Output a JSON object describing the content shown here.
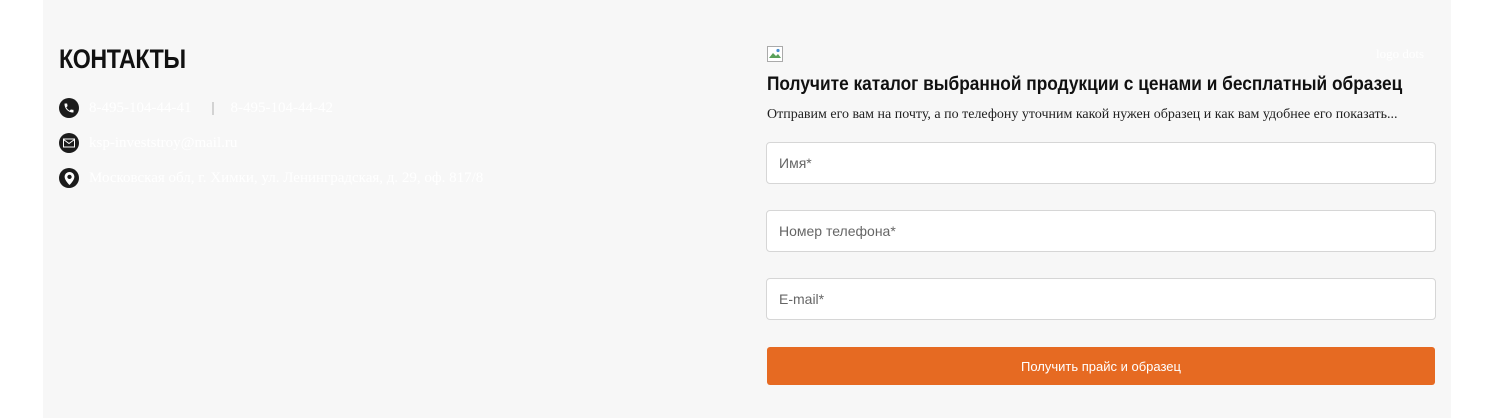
{
  "contacts": {
    "title": "КОНТАКТЫ",
    "phone_1": "8-495-104-44-41",
    "phone_separator": "|",
    "phone_2": "8-495-104-44-42",
    "email": "ksp-investstroy@mail.ru",
    "address": "Московская обл, г. Химки, ул. Ленинградская, д. 29, оф. 817/8"
  },
  "form": {
    "logo_alt": "logo dots",
    "title": "Получите каталог выбранной продукции с ценами и бесплатный образец",
    "subtitle": "Отправим его вам на почту, а по телефону уточним какой нужен образец и как вам удобнее его показать...",
    "name_placeholder": "Имя*",
    "phone_placeholder": "Номер телефона*",
    "email_placeholder": "E-mail*",
    "submit_label": "Получить прайс и образец"
  },
  "colors": {
    "accent": "#e66a22",
    "panel_background": "#f7f7f7",
    "contact_text": "#ffffff"
  },
  "icons": [
    "phone-icon",
    "mail-icon",
    "location-pin-icon",
    "broken-image-icon"
  ]
}
